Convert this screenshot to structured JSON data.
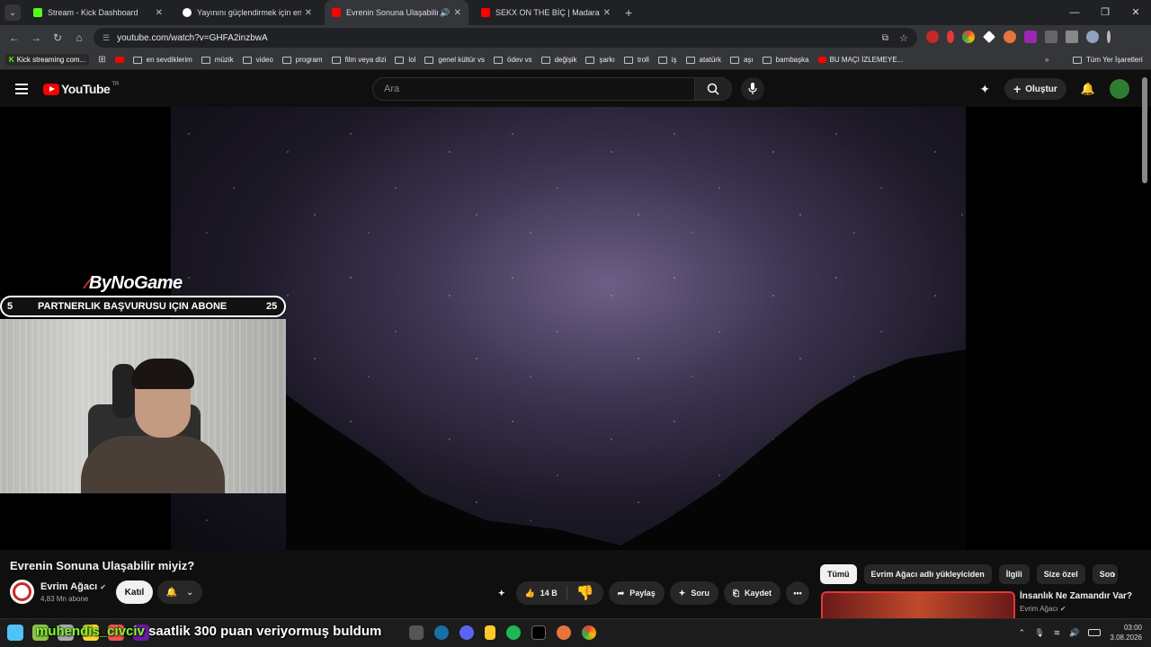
{
  "browser": {
    "tabs": [
      {
        "title": "Stream - Kick Dashboard",
        "color": "#53fc18",
        "active": false
      },
      {
        "title": "Yayınını güçlendirmek için en iyi",
        "color": "#ffffff",
        "active": false
      },
      {
        "title": "Evrenin Sonuna Ulaşabilir m",
        "color": "#ff0000",
        "active": true
      },
      {
        "title": "SEKX ON THE BİÇ | Madara Old",
        "color": "#ff0000",
        "active": false
      }
    ],
    "url": "youtube.com/watch?v=GHFA2inzbwA",
    "bookmarks": {
      "kick": "Kick streaming com...",
      "items": [
        "en sevdiklerim",
        "müzik",
        "video",
        "program",
        "film veya dizi",
        "lol",
        "genel kültür vs",
        "ödev vs",
        "değişik",
        "şarkı",
        "troll",
        "iş",
        "atatürk",
        "aşı",
        "bambaşka",
        "BU MAÇI İZLEMEYE..."
      ],
      "all_bookmarks": "Tüm Yer İşaretleri"
    }
  },
  "youtube": {
    "logo": "YouTube",
    "region": "TR",
    "search_placeholder": "Ara",
    "create_label": "Oluştur"
  },
  "stream_overlay": {
    "brand": "ByNoGame",
    "banner_left": "5",
    "banner_text": "PARTNERLIK BAŞVURUSU IÇIN ABONE",
    "banner_right": "25"
  },
  "video": {
    "title": "Evrenin Sonuna Ulaşabilir miyiz?",
    "channel": "Evrim Ağacı",
    "subscribers": "4,83 Mn abone",
    "join_label": "Katıl",
    "likes": "14 B",
    "share_label": "Paylaş",
    "ask_label": "Soru",
    "save_label": "Kaydet"
  },
  "sidebar": {
    "chips": [
      "Tümü",
      "Evrim Ağacı adlı yükleyiciden",
      "İlgili",
      "Size özel",
      "Son"
    ],
    "recommendation": {
      "title": "İnsanlık Ne Zamandır Var?",
      "channel": "Evrim Ağacı"
    }
  },
  "chat": {
    "user": "muhendis_civciv",
    "message": "saatlik 300 puan veriyormuş buldum"
  },
  "system": {
    "time": "03:00",
    "date": "3.08.2026"
  }
}
